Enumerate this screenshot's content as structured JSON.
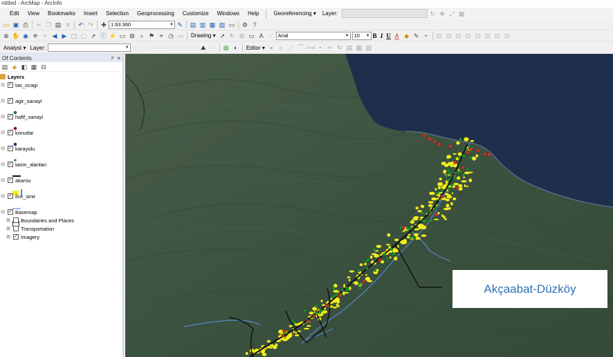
{
  "window": {
    "title": "ntitled - ArcMap - ArcInfo"
  },
  "menubar": {
    "items": [
      "Edit",
      "View",
      "Bookmarks",
      "Insert",
      "Selection",
      "Geoprocessing",
      "Customize",
      "Windows",
      "Help"
    ],
    "georeferencing": "Georeferencing ▾",
    "layer_label": "Layer:"
  },
  "toolbar1": {
    "scale_value": "1:63.360"
  },
  "toolbar2": {
    "drawing_label": "Drawing ▾",
    "font_name": "Arial",
    "font_size": "10",
    "bold": "B",
    "italic": "I",
    "underline": "U"
  },
  "toolbar3": {
    "analyst_label": "Analyst ▾",
    "layer_label": "Layer:",
    "editor_label": "Editor ▾"
  },
  "toc": {
    "title": "Of Contents",
    "pin": "ᵖ",
    "close": "×",
    "root_label": "Layers",
    "layers": [
      {
        "label": "tas_ocagi",
        "checked": true
      },
      {
        "label": "agir_sanayi",
        "checked": true
      },
      {
        "label": "hafif_sanayi",
        "checked": true
      },
      {
        "label": "konutlar",
        "checked": true
      },
      {
        "label": "karayolu",
        "checked": true
      },
      {
        "label": "tarim_alanlari",
        "checked": true
      },
      {
        "label": "akarsu",
        "checked": true
      },
      {
        "label": "ilce_sinir",
        "checked": true
      },
      {
        "label": "Basemap",
        "checked": true
      }
    ],
    "basemap_children": [
      {
        "label": "Boundaries and Places",
        "checked": false
      },
      {
        "label": "Transportation",
        "checked": false
      },
      {
        "label": "Imagery",
        "checked": true
      }
    ]
  },
  "map": {
    "callout_label": "Akçaabat-Düzköy",
    "colors": {
      "sea": "#1d2f4a",
      "land": "#3e5340",
      "agriculture": "#f2ee1c",
      "settlement": "#1f9a2e",
      "heavy_industry": "#c0392b",
      "road": "#111111",
      "river": "#5a8fd8"
    }
  }
}
